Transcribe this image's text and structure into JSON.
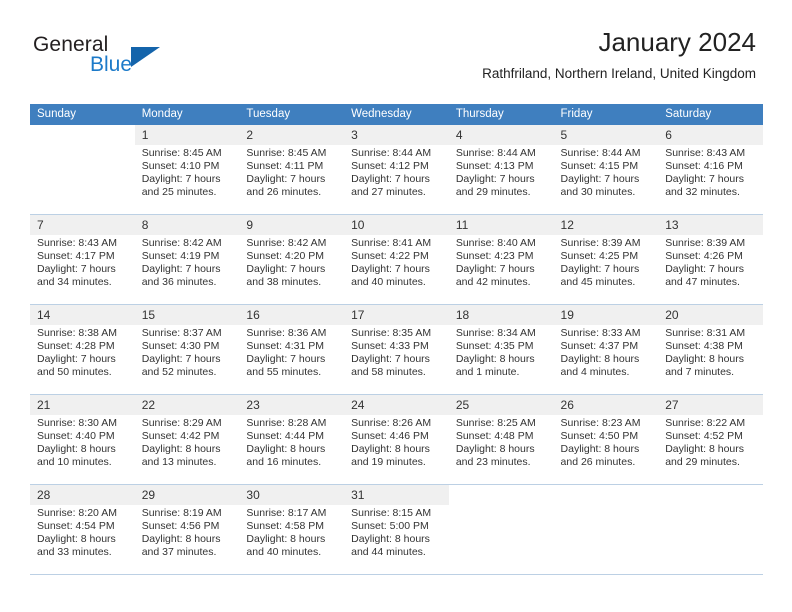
{
  "brand": {
    "name_part1": "General",
    "name_part2": "Blue",
    "logo_icon": "triangle-play-icon"
  },
  "header": {
    "month_title": "January 2024",
    "location": "Rathfriland, Northern Ireland, United Kingdom"
  },
  "colors": {
    "header_row_bg": "#3f7fbf",
    "header_row_text": "#ffffff",
    "daynum_bg": "#f0f0f0",
    "row_divider": "#bcd0e4",
    "brand_blue": "#1c7ac9",
    "brand_dark": "#231f20",
    "body_text": "#333333"
  },
  "calendar": {
    "weekday_headers": [
      "Sunday",
      "Monday",
      "Tuesday",
      "Wednesday",
      "Thursday",
      "Friday",
      "Saturday"
    ],
    "weeks": [
      [
        {
          "day": "",
          "sunrise": "",
          "sunset": "",
          "daylight1": "",
          "daylight2": ""
        },
        {
          "day": "1",
          "sunrise": "Sunrise: 8:45 AM",
          "sunset": "Sunset: 4:10 PM",
          "daylight1": "Daylight: 7 hours",
          "daylight2": "and 25 minutes."
        },
        {
          "day": "2",
          "sunrise": "Sunrise: 8:45 AM",
          "sunset": "Sunset: 4:11 PM",
          "daylight1": "Daylight: 7 hours",
          "daylight2": "and 26 minutes."
        },
        {
          "day": "3",
          "sunrise": "Sunrise: 8:44 AM",
          "sunset": "Sunset: 4:12 PM",
          "daylight1": "Daylight: 7 hours",
          "daylight2": "and 27 minutes."
        },
        {
          "day": "4",
          "sunrise": "Sunrise: 8:44 AM",
          "sunset": "Sunset: 4:13 PM",
          "daylight1": "Daylight: 7 hours",
          "daylight2": "and 29 minutes."
        },
        {
          "day": "5",
          "sunrise": "Sunrise: 8:44 AM",
          "sunset": "Sunset: 4:15 PM",
          "daylight1": "Daylight: 7 hours",
          "daylight2": "and 30 minutes."
        },
        {
          "day": "6",
          "sunrise": "Sunrise: 8:43 AM",
          "sunset": "Sunset: 4:16 PM",
          "daylight1": "Daylight: 7 hours",
          "daylight2": "and 32 minutes."
        }
      ],
      [
        {
          "day": "7",
          "sunrise": "Sunrise: 8:43 AM",
          "sunset": "Sunset: 4:17 PM",
          "daylight1": "Daylight: 7 hours",
          "daylight2": "and 34 minutes."
        },
        {
          "day": "8",
          "sunrise": "Sunrise: 8:42 AM",
          "sunset": "Sunset: 4:19 PM",
          "daylight1": "Daylight: 7 hours",
          "daylight2": "and 36 minutes."
        },
        {
          "day": "9",
          "sunrise": "Sunrise: 8:42 AM",
          "sunset": "Sunset: 4:20 PM",
          "daylight1": "Daylight: 7 hours",
          "daylight2": "and 38 minutes."
        },
        {
          "day": "10",
          "sunrise": "Sunrise: 8:41 AM",
          "sunset": "Sunset: 4:22 PM",
          "daylight1": "Daylight: 7 hours",
          "daylight2": "and 40 minutes."
        },
        {
          "day": "11",
          "sunrise": "Sunrise: 8:40 AM",
          "sunset": "Sunset: 4:23 PM",
          "daylight1": "Daylight: 7 hours",
          "daylight2": "and 42 minutes."
        },
        {
          "day": "12",
          "sunrise": "Sunrise: 8:39 AM",
          "sunset": "Sunset: 4:25 PM",
          "daylight1": "Daylight: 7 hours",
          "daylight2": "and 45 minutes."
        },
        {
          "day": "13",
          "sunrise": "Sunrise: 8:39 AM",
          "sunset": "Sunset: 4:26 PM",
          "daylight1": "Daylight: 7 hours",
          "daylight2": "and 47 minutes."
        }
      ],
      [
        {
          "day": "14",
          "sunrise": "Sunrise: 8:38 AM",
          "sunset": "Sunset: 4:28 PM",
          "daylight1": "Daylight: 7 hours",
          "daylight2": "and 50 minutes."
        },
        {
          "day": "15",
          "sunrise": "Sunrise: 8:37 AM",
          "sunset": "Sunset: 4:30 PM",
          "daylight1": "Daylight: 7 hours",
          "daylight2": "and 52 minutes."
        },
        {
          "day": "16",
          "sunrise": "Sunrise: 8:36 AM",
          "sunset": "Sunset: 4:31 PM",
          "daylight1": "Daylight: 7 hours",
          "daylight2": "and 55 minutes."
        },
        {
          "day": "17",
          "sunrise": "Sunrise: 8:35 AM",
          "sunset": "Sunset: 4:33 PM",
          "daylight1": "Daylight: 7 hours",
          "daylight2": "and 58 minutes."
        },
        {
          "day": "18",
          "sunrise": "Sunrise: 8:34 AM",
          "sunset": "Sunset: 4:35 PM",
          "daylight1": "Daylight: 8 hours",
          "daylight2": "and 1 minute."
        },
        {
          "day": "19",
          "sunrise": "Sunrise: 8:33 AM",
          "sunset": "Sunset: 4:37 PM",
          "daylight1": "Daylight: 8 hours",
          "daylight2": "and 4 minutes."
        },
        {
          "day": "20",
          "sunrise": "Sunrise: 8:31 AM",
          "sunset": "Sunset: 4:38 PM",
          "daylight1": "Daylight: 8 hours",
          "daylight2": "and 7 minutes."
        }
      ],
      [
        {
          "day": "21",
          "sunrise": "Sunrise: 8:30 AM",
          "sunset": "Sunset: 4:40 PM",
          "daylight1": "Daylight: 8 hours",
          "daylight2": "and 10 minutes."
        },
        {
          "day": "22",
          "sunrise": "Sunrise: 8:29 AM",
          "sunset": "Sunset: 4:42 PM",
          "daylight1": "Daylight: 8 hours",
          "daylight2": "and 13 minutes."
        },
        {
          "day": "23",
          "sunrise": "Sunrise: 8:28 AM",
          "sunset": "Sunset: 4:44 PM",
          "daylight1": "Daylight: 8 hours",
          "daylight2": "and 16 minutes."
        },
        {
          "day": "24",
          "sunrise": "Sunrise: 8:26 AM",
          "sunset": "Sunset: 4:46 PM",
          "daylight1": "Daylight: 8 hours",
          "daylight2": "and 19 minutes."
        },
        {
          "day": "25",
          "sunrise": "Sunrise: 8:25 AM",
          "sunset": "Sunset: 4:48 PM",
          "daylight1": "Daylight: 8 hours",
          "daylight2": "and 23 minutes."
        },
        {
          "day": "26",
          "sunrise": "Sunrise: 8:23 AM",
          "sunset": "Sunset: 4:50 PM",
          "daylight1": "Daylight: 8 hours",
          "daylight2": "and 26 minutes."
        },
        {
          "day": "27",
          "sunrise": "Sunrise: 8:22 AM",
          "sunset": "Sunset: 4:52 PM",
          "daylight1": "Daylight: 8 hours",
          "daylight2": "and 29 minutes."
        }
      ],
      [
        {
          "day": "28",
          "sunrise": "Sunrise: 8:20 AM",
          "sunset": "Sunset: 4:54 PM",
          "daylight1": "Daylight: 8 hours",
          "daylight2": "and 33 minutes."
        },
        {
          "day": "29",
          "sunrise": "Sunrise: 8:19 AM",
          "sunset": "Sunset: 4:56 PM",
          "daylight1": "Daylight: 8 hours",
          "daylight2": "and 37 minutes."
        },
        {
          "day": "30",
          "sunrise": "Sunrise: 8:17 AM",
          "sunset": "Sunset: 4:58 PM",
          "daylight1": "Daylight: 8 hours",
          "daylight2": "and 40 minutes."
        },
        {
          "day": "31",
          "sunrise": "Sunrise: 8:15 AM",
          "sunset": "Sunset: 5:00 PM",
          "daylight1": "Daylight: 8 hours",
          "daylight2": "and 44 minutes."
        },
        {
          "day": "",
          "sunrise": "",
          "sunset": "",
          "daylight1": "",
          "daylight2": ""
        },
        {
          "day": "",
          "sunrise": "",
          "sunset": "",
          "daylight1": "",
          "daylight2": ""
        },
        {
          "day": "",
          "sunrise": "",
          "sunset": "",
          "daylight1": "",
          "daylight2": ""
        }
      ]
    ]
  }
}
